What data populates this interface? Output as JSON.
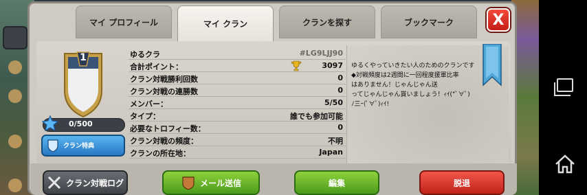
{
  "tabs": [
    {
      "label": "マイ プロフィール"
    },
    {
      "label": "マイ クラン"
    },
    {
      "label": "クランを探す"
    },
    {
      "label": "ブックマーク"
    }
  ],
  "close_label": "X",
  "clan": {
    "level": "1",
    "xp": "0/500",
    "perks_label": "クラン特典",
    "name": "ゆるクラ",
    "tag": "#LG9LJJ90",
    "rows": [
      {
        "label": "合計ポイント：",
        "value": "3097"
      },
      {
        "label": "クラン対戦勝利回数",
        "value": "0"
      },
      {
        "label": "クラン対戦の連勝数",
        "value": "0"
      },
      {
        "label": "メンバー：",
        "value": "5/50"
      },
      {
        "label": "タイプ：",
        "value": "誰でも参加可能"
      },
      {
        "label": "必要なトロフィー数：",
        "value": "0"
      },
      {
        "label": "クラン対戦の頻度：",
        "value": "不明"
      },
      {
        "label": "クランの所在地：",
        "value": "Japan"
      }
    ],
    "description_lines": [
      "ゆるくやっていきたい人のためのクランです",
      "◆対戦頻度は2週間に一回程度援軍比率",
      "はありません！じゃんじゃん送",
      "ってじゃんじゃん貰いましょう！ｨｲ(*ﾟ∀ﾟ)",
      "ﾉ三ｰ(ﾟ∀ﾟ)ｨｲ!"
    ]
  },
  "footer": {
    "war_log": "クラン対戦ログ",
    "send_mail": "メール送信",
    "edit": "編集",
    "leave": "脱退"
  }
}
